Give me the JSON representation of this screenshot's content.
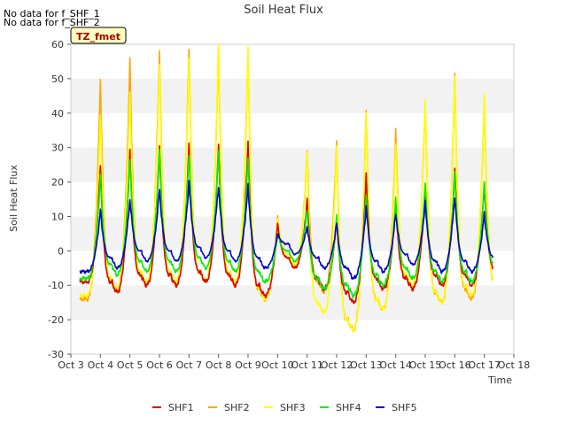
{
  "notes": [
    "No data for f_SHF_1",
    "No data for f_SHF_2"
  ],
  "badge": "TZ_fmet",
  "chart_data": {
    "type": "line",
    "title": "Soil Heat Flux",
    "xlabel": "Time",
    "ylabel": "Soil Heat Flux",
    "ylim": [
      -30,
      60
    ],
    "xlim": [
      "Oct 3",
      "Oct 18"
    ],
    "x_ticks": [
      "Oct 3",
      "Oct 4",
      "Oct 5",
      "Oct 6",
      "Oct 7",
      "Oct 8",
      "Oct 9",
      "Oct 10",
      "Oct 11",
      "Oct 12",
      "Oct 13",
      "Oct 14",
      "Oct 15",
      "Oct 16",
      "Oct 17",
      "Oct 18"
    ],
    "y_ticks": [
      -30,
      -20,
      -10,
      0,
      10,
      20,
      30,
      40,
      50,
      60
    ],
    "grid": "horizontal bands",
    "legend": "bottom",
    "data_start_day": 3.3,
    "data_end_day": 17.3,
    "daily_peak_day": [
      4.0,
      5.0,
      6.0,
      7.0,
      8.0,
      9.0,
      10.0,
      11.0,
      12.0,
      13.0,
      14.0,
      15.0,
      16.0,
      17.0
    ],
    "series": [
      {
        "name": "SHF1",
        "color": "#e00000",
        "night": [
          -9,
          -12,
          -10,
          -10,
          -9,
          -10,
          -13,
          -5,
          -11,
          -15,
          -11,
          -11,
          -10,
          -10,
          -8
        ],
        "peak": [
          25,
          29,
          31,
          31,
          31,
          32,
          8,
          15,
          10,
          22,
          14,
          19,
          24,
          20,
          10
        ]
      },
      {
        "name": "SHF2",
        "color": "#ffa500",
        "night": [
          -14,
          -12,
          -10,
          -10,
          -9,
          -10,
          -14,
          -5,
          -12,
          -23,
          -17,
          -11,
          -15,
          -14,
          -12
        ],
        "peak": [
          50,
          56,
          58,
          59,
          59,
          58,
          10,
          29,
          32,
          41,
          35,
          44,
          51,
          44,
          10
        ]
      },
      {
        "name": "SHF3",
        "color": "#ffff00",
        "night": [
          -13,
          -11,
          -9,
          -9,
          -9,
          -9,
          -14,
          -4,
          -18,
          -23,
          -17,
          -10,
          -15,
          -13,
          -12
        ],
        "peak": [
          40,
          46,
          54,
          56,
          60,
          59,
          10,
          28,
          31,
          40,
          31,
          44,
          51,
          45,
          10
        ]
      },
      {
        "name": "SHF4",
        "color": "#00ee00",
        "night": [
          -8,
          -7,
          -6,
          -6,
          -5,
          -6,
          -9,
          -3,
          -11,
          -13,
          -10,
          -8,
          -9,
          -9,
          -7
        ],
        "peak": [
          22,
          27,
          29,
          28,
          29,
          27,
          5,
          12,
          10,
          17,
          15,
          20,
          23,
          20,
          8
        ]
      },
      {
        "name": "SHF5",
        "color": "#0000cc",
        "night": [
          -6,
          -5,
          -3,
          -3,
          -2,
          -3,
          -5,
          -1,
          -5,
          -8,
          -6,
          -4,
          -6,
          -6,
          -5
        ],
        "peak": [
          12,
          15,
          18,
          20,
          19,
          19,
          5,
          7,
          8,
          13,
          11,
          14,
          16,
          11,
          7
        ]
      }
    ]
  }
}
